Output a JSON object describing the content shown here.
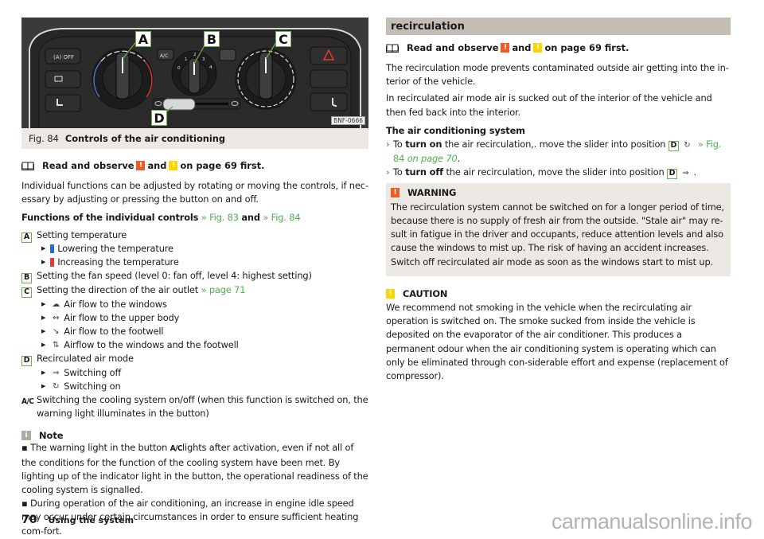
{
  "figure": {
    "number": "Fig. 84",
    "caption": "Controls of the air conditioning",
    "code": "BNF-0666",
    "callouts": [
      "A",
      "B",
      "C",
      "D"
    ],
    "panel_labels": {
      "off_button": "OFF",
      "ac_button": "A/C",
      "fan_levels": [
        "0",
        "1",
        "2",
        "3",
        "4"
      ]
    }
  },
  "left": {
    "read_observe": {
      "prefix": "Read and observe",
      "warning_mark": "!",
      "and": "and",
      "caution_mark": "!",
      "suffix": "on page 69 first."
    },
    "intro": "Individual functions can be adjusted by rotating or moving the controls, if nec-essary by adjusting or pressing the button on and off.",
    "functions_heading": {
      "text": "Functions of the individual controls",
      "link1": "» Fig. 83",
      "and": "and",
      "link2": "» Fig. 84"
    },
    "controls": [
      {
        "key": "A",
        "text": "Setting temperature",
        "subs": [
          {
            "icon": "blue-bar-icon",
            "text": "Lowering the temperature"
          },
          {
            "icon": "red-bar-icon",
            "text": "Increasing the temperature"
          }
        ]
      },
      {
        "key": "B",
        "text": "Setting the fan speed (level 0: fan off, level 4: highest setting)",
        "subs": []
      },
      {
        "key": "C",
        "text": "Setting the direction of the air outlet",
        "link": "» page 71",
        "subs": [
          {
            "icon": "windscreen-airflow-icon",
            "text": "Air flow to the windows"
          },
          {
            "icon": "upper-body-airflow-icon",
            "text": "Air flow to the upper body"
          },
          {
            "icon": "footwell-airflow-icon",
            "text": "Air flow to the footwell"
          },
          {
            "icon": "windows-footwell-airflow-icon",
            "text": "Airflow to the windows and the footwell"
          }
        ]
      },
      {
        "key": "D",
        "text": "Recirculated air mode",
        "subs": [
          {
            "icon": "fresh-air-icon",
            "text": "Switching off"
          },
          {
            "icon": "recirculation-icon",
            "text": "Switching on"
          }
        ]
      },
      {
        "key": "A/C",
        "text": "Switching the cooling system on/off (when this function is switched on, the warning light illuminates in the button)",
        "subs": []
      }
    ],
    "note": {
      "title": "Note",
      "items": [
        {
          "pre": "The warning light in the button",
          "key": "A/C",
          "post": "lights after activation, even if not all of the conditions for the function of the cooling system have been met. By lighting up of the indicator light in the button, the operational readiness of the cooling system is signalled."
        },
        {
          "pre": "During operation of the air conditioning, an increase in engine idle speed may occur under certain circumstances in order to ensure sufficient heating com-fort.",
          "key": "",
          "post": ""
        }
      ]
    }
  },
  "right": {
    "section_title": "recirculation",
    "read_observe": {
      "prefix": "Read and observe",
      "warning_mark": "!",
      "and": "and",
      "caution_mark": "!",
      "suffix": "on page 69 first."
    },
    "para1": "The recirculation mode prevents contaminated outside air getting into the in-terior of the vehicle.",
    "para2": "In recirculated air mode air is sucked out of the interior of the vehicle and then fed back into the interior.",
    "subheading": "The air conditioning system",
    "steps": [
      {
        "pre": "To",
        "bold": "turn on",
        "mid": "the air recirculation,. move the slider into position",
        "key": "D",
        "icon": "recirculation-icon",
        "link": "» Fig. 84",
        "link_tail": "on page 70",
        "end": "."
      },
      {
        "pre": "To",
        "bold": "turn off",
        "mid": "the air recirculation, move the slider into position",
        "key": "D",
        "icon": "fresh-air-icon",
        "link": "",
        "link_tail": "",
        "end": "."
      }
    ],
    "warning": {
      "mark": "!",
      "title": "WARNING",
      "text": "The recirculation system cannot be switched on for a longer period of time, because there is no supply of fresh air from the outside. \"Stale air\" may re-sult in fatigue in the driver and occupants, reduce attention levels and also cause the windows to mist up. The risk of having an accident increases. Switch off recirculated air mode as soon as the windows start to mist up."
    },
    "caution": {
      "mark": "!",
      "title": "CAUTION",
      "text": "We recommend not smoking in the vehicle when the recirculating air operation is switched on. The smoke sucked from inside the vehicle is deposited on the evaporator of the air conditioner. This produces a permanent odour when the air conditioning system is operating which can only be eliminated through con-siderable effort and expense (replacement of compressor)."
    }
  },
  "footer": {
    "page_number": "70",
    "section": "Using the system"
  },
  "watermark": "carmanualsonline.info",
  "colors": {
    "accent_green": "#4caf50",
    "warning_red": "#f15a24",
    "caution_yellow": "#ffd500",
    "note_grey": "#b0a9a0",
    "section_header_bg": "#c4bdb6",
    "box_bg": "#ece9e4",
    "temp_cold": "#1e6fd9",
    "temp_hot": "#e53935"
  }
}
